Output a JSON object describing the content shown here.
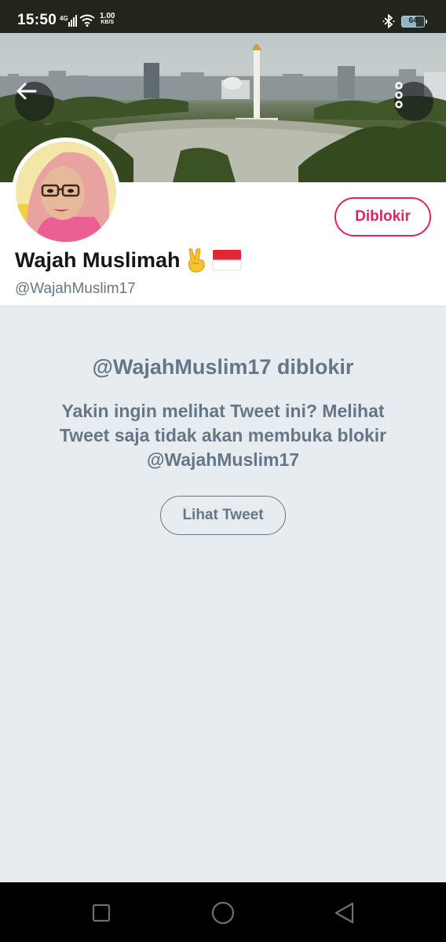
{
  "status_bar": {
    "time": "15:50",
    "network": "4G",
    "speed_value": "1.00",
    "speed_unit": "KB/S",
    "battery": "64",
    "battery_level": 0.64,
    "icons": [
      "signal-icon",
      "wifi-icon",
      "bluetooth-icon",
      "battery-icon"
    ]
  },
  "header": {
    "back_icon": "arrow-left-icon",
    "more_icon": "more-vertical-icon"
  },
  "profile": {
    "display_name": "Wajah Muslimah",
    "name_emojis": [
      "victory-hand-emoji",
      "indonesia-flag-emoji"
    ],
    "handle": "@WajahMuslim17",
    "blocked_button_label": "Diblokir"
  },
  "blocked_notice": {
    "title": "@WajahMuslim17 diblokir",
    "body": "Yakin ingin melihat Tweet ini? Melihat Tweet saja tidak akan membuka blokir @WajahMuslim17",
    "view_button_label": "Lihat Tweet"
  },
  "nav_bar": {
    "icons": [
      "recent-apps-icon",
      "home-icon",
      "back-triangle-icon"
    ]
  },
  "colors": {
    "accent_red": "#e0245e",
    "secondary_text": "#657786",
    "background": "#e6ecf0",
    "status_bar": "#23241a"
  }
}
